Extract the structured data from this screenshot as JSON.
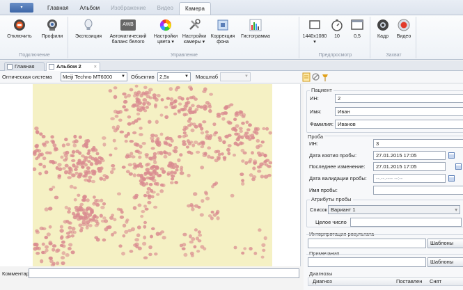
{
  "ribbon": {
    "app_menu": "▾",
    "tabs": [
      {
        "label": "Главная",
        "state": "normal"
      },
      {
        "label": "Альбом",
        "state": "normal"
      },
      {
        "label": "Изображение",
        "state": "disabled"
      },
      {
        "label": "Видео",
        "state": "disabled"
      },
      {
        "label": "Камера",
        "state": "active"
      }
    ],
    "groups": {
      "connection": {
        "label": "Подключение",
        "disconnect": "Отключить",
        "profiles": "Профили"
      },
      "control": {
        "label": "Управление",
        "exposure": "Экспозиция",
        "awb_line1": "Автоматический",
        "awb_line2": "баланс белого",
        "awb_icon_text": "AWB",
        "color_line1": "Настройки",
        "color_line2": "цвета ▾",
        "camera_line1": "Настройки",
        "camera_line2": "камеры ▾",
        "bg_line1": "Коррекция",
        "bg_line2": "фона",
        "histogram": "Гистограмма"
      },
      "preview": {
        "label": "Предпросмотр",
        "resolution": "1440x1080",
        "resolution_arrow": "▾",
        "fps": "10",
        "scale": "0,5"
      },
      "capture": {
        "label": "Захват",
        "frame": "Кадр",
        "video": "Видео"
      }
    }
  },
  "doc_tabs": {
    "home": "Главная",
    "album": "Альбом 2",
    "close": "×"
  },
  "toolbar": {
    "optical_label": "Оптическая система",
    "optical_value": "Meiji Techno MT6000",
    "objective_label": "Объектив",
    "objective_value": "2,5x",
    "scale_label": "Масштаб",
    "scale_value": ""
  },
  "comments": {
    "label": "Комментарии:",
    "value": ""
  },
  "patient": {
    "title": "Пациент",
    "id_label": "ИН:",
    "id_value": "2",
    "name_label": "Имя:",
    "name_value": "Иван",
    "surname_label": "Фамилия:",
    "surname_value": "Иванов"
  },
  "sample": {
    "title": "Проба",
    "id_label": "ИН:",
    "id_value": "3",
    "taken_label": "Дата взятия пробы:",
    "taken_value": "27.01.2015 17:05",
    "modified_label": "Последнее изменение:",
    "modified_value": "27.01.2015 17:05",
    "validated_label": "Дата валидации пробы:",
    "validated_value": "--.--.---- --:--",
    "name_label": "Имя пробы:",
    "name_value": ""
  },
  "attributes": {
    "title": "Атрибуты пробы",
    "list_label": "Список",
    "list_value": "Вариант 1",
    "list_arrow": "▾",
    "int_label": "Целое число",
    "int_value": ""
  },
  "interpretation": {
    "title": "Интерпретация результата",
    "value": "",
    "templates": "Шаблоны"
  },
  "notes": {
    "title": "Примечания",
    "value": "",
    "templates": "Шаблоны"
  },
  "diagnoses": {
    "title": "Диагнозы",
    "columns": [
      "Диагноз",
      "Поставлен",
      "Снят"
    ]
  },
  "colors": {
    "accent": "#3c65a6",
    "image_bg": "#f5f1c4",
    "cell": "#d98a8f"
  }
}
